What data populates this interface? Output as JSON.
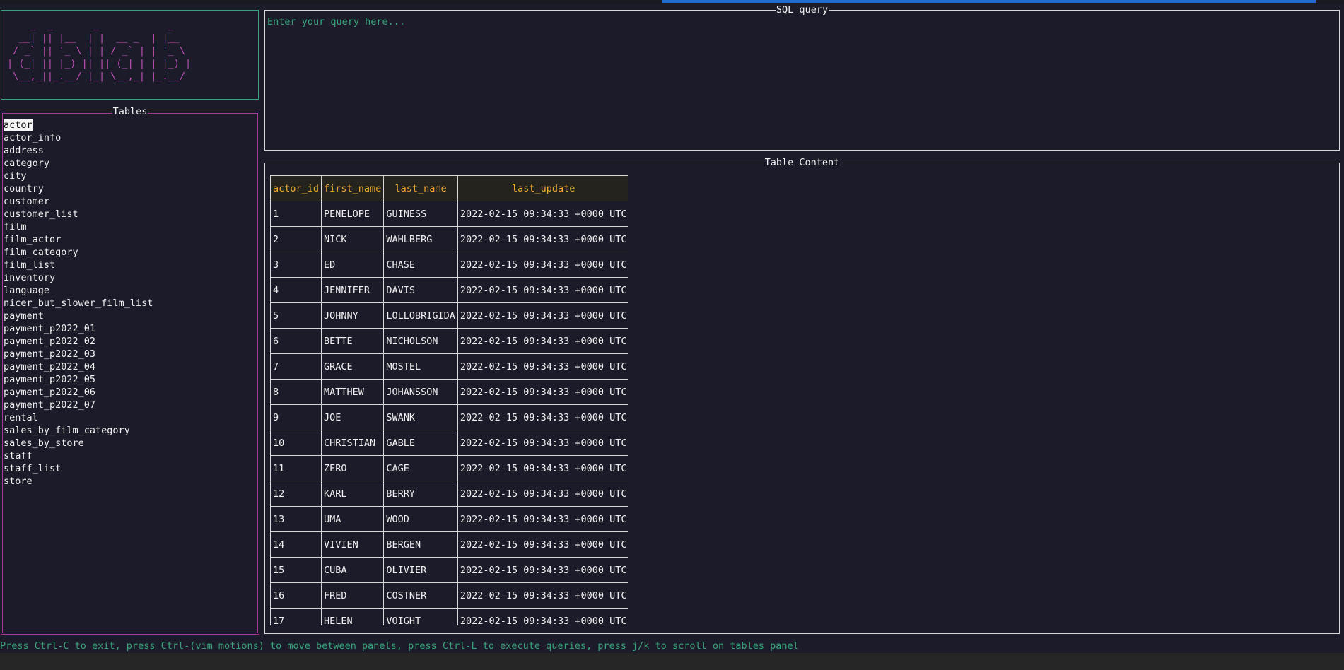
{
  "logo": {
    "art": "    _  _       _            _\n  __| || |__  | |  __ _  | |__\n / _` || '_ \\ | | / _` | | '_ \\\n| (_| || |_) || || (_| | | |_) |\n \\__,_||_.__/ |_| \\__,_| |_.__/"
  },
  "tables_panel": {
    "title": "Tables",
    "items": [
      "actor",
      "actor_info",
      "address",
      "category",
      "city",
      "country",
      "customer",
      "customer_list",
      "film",
      "film_actor",
      "film_category",
      "film_list",
      "inventory",
      "language",
      "nicer_but_slower_film_list",
      "payment",
      "payment_p2022_01",
      "payment_p2022_02",
      "payment_p2022_03",
      "payment_p2022_04",
      "payment_p2022_05",
      "payment_p2022_06",
      "payment_p2022_07",
      "rental",
      "sales_by_film_category",
      "sales_by_store",
      "staff",
      "staff_list",
      "store"
    ],
    "selected": "actor"
  },
  "sql_panel": {
    "title": "SQL query",
    "placeholder": "Enter your query here..."
  },
  "content_panel": {
    "title": "Table Content",
    "columns": [
      "actor_id",
      "first_name",
      "last_name",
      "last_update"
    ],
    "rows": [
      [
        "1",
        "PENELOPE",
        "GUINESS",
        "2022-02-15 09:34:33 +0000 UTC"
      ],
      [
        "2",
        "NICK",
        "WAHLBERG",
        "2022-02-15 09:34:33 +0000 UTC"
      ],
      [
        "3",
        "ED",
        "CHASE",
        "2022-02-15 09:34:33 +0000 UTC"
      ],
      [
        "4",
        "JENNIFER",
        "DAVIS",
        "2022-02-15 09:34:33 +0000 UTC"
      ],
      [
        "5",
        "JOHNNY",
        "LOLLOBRIGIDA",
        "2022-02-15 09:34:33 +0000 UTC"
      ],
      [
        "6",
        "BETTE",
        "NICHOLSON",
        "2022-02-15 09:34:33 +0000 UTC"
      ],
      [
        "7",
        "GRACE",
        "MOSTEL",
        "2022-02-15 09:34:33 +0000 UTC"
      ],
      [
        "8",
        "MATTHEW",
        "JOHANSSON",
        "2022-02-15 09:34:33 +0000 UTC"
      ],
      [
        "9",
        "JOE",
        "SWANK",
        "2022-02-15 09:34:33 +0000 UTC"
      ],
      [
        "10",
        "CHRISTIAN",
        "GABLE",
        "2022-02-15 09:34:33 +0000 UTC"
      ],
      [
        "11",
        "ZERO",
        "CAGE",
        "2022-02-15 09:34:33 +0000 UTC"
      ],
      [
        "12",
        "KARL",
        "BERRY",
        "2022-02-15 09:34:33 +0000 UTC"
      ],
      [
        "13",
        "UMA",
        "WOOD",
        "2022-02-15 09:34:33 +0000 UTC"
      ],
      [
        "14",
        "VIVIEN",
        "BERGEN",
        "2022-02-15 09:34:33 +0000 UTC"
      ],
      [
        "15",
        "CUBA",
        "OLIVIER",
        "2022-02-15 09:34:33 +0000 UTC"
      ],
      [
        "16",
        "FRED",
        "COSTNER",
        "2022-02-15 09:34:33 +0000 UTC"
      ],
      [
        "17",
        "HELEN",
        "VOIGHT",
        "2022-02-15 09:34:33 +0000 UTC"
      ]
    ]
  },
  "status_bar": {
    "text": "Press Ctrl-C to exit, press Ctrl-(vim motions) to move between panels, press Ctrl-L to execute queries, press j/k to scroll on tables panel"
  },
  "colors": {
    "background": "#1c1b29",
    "accent_green": "#3aa27a",
    "accent_magenta": "#a23a98",
    "header_orange": "#f0a830",
    "progress_blue": "#1f6bd0"
  }
}
